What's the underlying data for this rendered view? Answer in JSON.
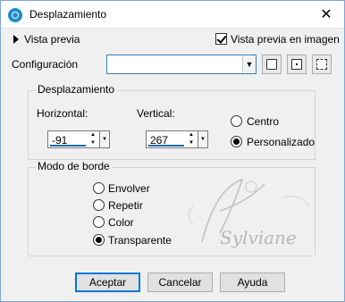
{
  "window": {
    "title": "Desplazamiento",
    "close_glyph": "✕"
  },
  "preview": {
    "label": "Vista previa",
    "checkbox_label": "Vista previa en imagen",
    "checked": true
  },
  "config": {
    "label": "Configuración",
    "value": ""
  },
  "displacement": {
    "title": "Desplazamiento",
    "horizontal_label": "Horizontal:",
    "horizontal_value": "-91",
    "vertical_label": "Vertical:",
    "vertical_value": "267",
    "radio_center": "Centro",
    "radio_custom": "Personalizado",
    "selected": "Personalizado"
  },
  "edge_mode": {
    "title": "Modo de borde",
    "options": [
      "Envolver",
      "Repetir",
      "Color",
      "Transparente"
    ],
    "selected": "Transparente"
  },
  "buttons": {
    "ok": "Aceptar",
    "cancel": "Cancelar",
    "help": "Ayuda"
  },
  "watermark_text": "Sylviane",
  "icons": [
    "app-icon",
    "save-icon",
    "random-die-icon",
    "reset-icon"
  ]
}
